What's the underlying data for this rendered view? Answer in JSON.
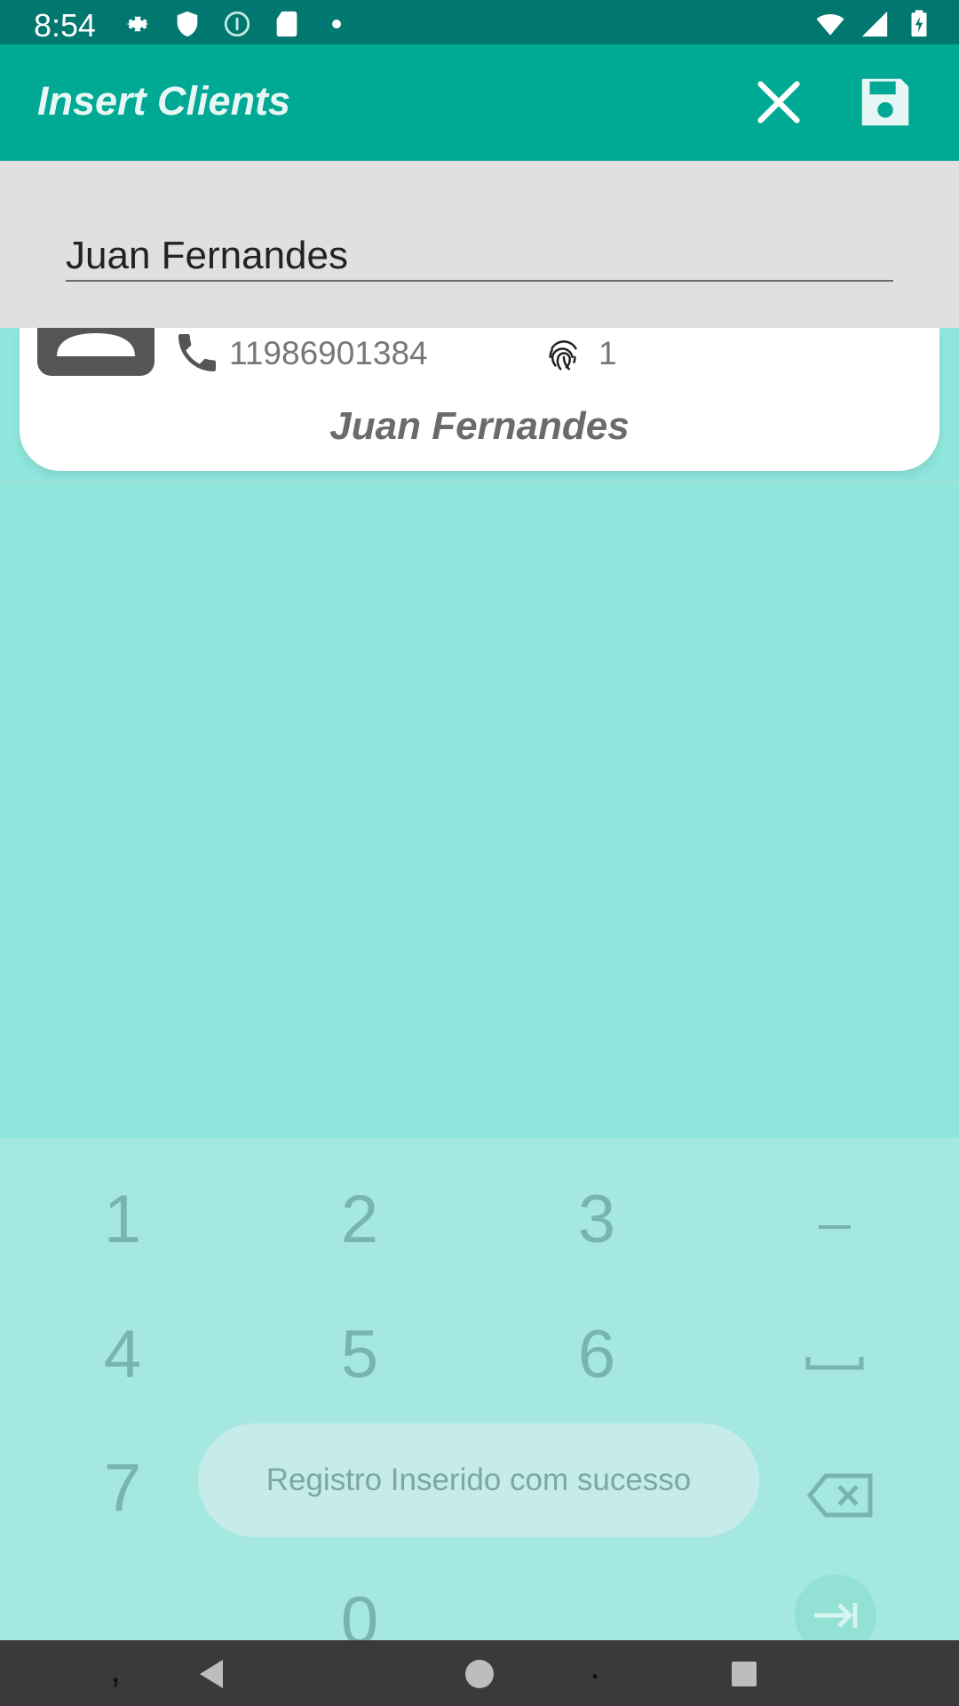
{
  "status_bar": {
    "time": "8:54",
    "left_icons": [
      "gear-icon",
      "shield-icon",
      "info-icon",
      "sd-card-icon",
      "dot-icon"
    ],
    "right_icons": [
      "wifi-icon",
      "signal-icon",
      "battery-charging-icon"
    ]
  },
  "app_bar": {
    "title": "Insert Clients",
    "close_icon": "close-icon",
    "save_icon": "save-icon"
  },
  "search": {
    "value": "Juan Fernandes"
  },
  "client_card": {
    "phone": "11986901384",
    "id_value": "1",
    "name": "Juan Fernandes",
    "avatar_icon": "avatar-icon",
    "phone_icon": "phone-icon",
    "fingerprint_icon": "fingerprint-icon"
  },
  "keyboard": {
    "keys": {
      "k1": "1",
      "k2": "2",
      "k3": "3",
      "k4": "4",
      "k5": "5",
      "k6": "6",
      "k7": "7",
      "k8": "8",
      "k9": "9",
      "k0": "0",
      "comma": ",",
      "period": "."
    },
    "special_keys": [
      "minus-icon",
      "space-icon",
      "backspace-icon",
      "enter-icon"
    ]
  },
  "toast": {
    "message": "Registro Inserido com sucesso"
  },
  "nav_bar": {
    "buttons": [
      "back-icon",
      "home-icon",
      "recents-icon"
    ]
  },
  "colors": {
    "status_bar": "#00786f",
    "app_bar": "#00a993",
    "background": "#8fe6dc",
    "keyboard": "#a4e8e1",
    "search_panel": "#e0e0e0",
    "nav_bar": "#3a3a3a"
  }
}
